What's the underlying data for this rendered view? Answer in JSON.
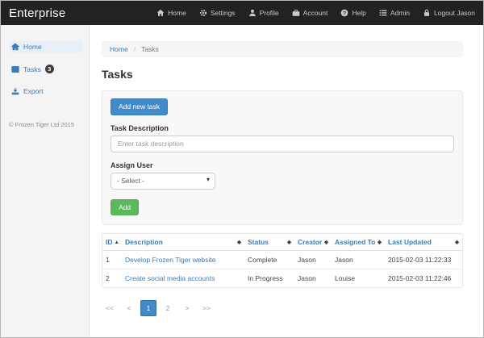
{
  "colors": {
    "navbar_bg": "#222222",
    "accent_blue": "#428bca",
    "link_blue": "#3c7cb7",
    "success_green": "#5cb85c",
    "sidebar_bg": "#f4f4f4",
    "badge_bg": "#3d3d3d"
  },
  "navbar": {
    "brand": "Enterprise",
    "items": [
      {
        "label": "Home",
        "icon": "home-icon"
      },
      {
        "label": "Settings",
        "icon": "gear-icon"
      },
      {
        "label": "Profile",
        "icon": "user-icon"
      },
      {
        "label": "Account",
        "icon": "briefcase-icon"
      },
      {
        "label": "Help",
        "icon": "help-circle-icon"
      },
      {
        "label": "Admin",
        "icon": "list-icon"
      },
      {
        "label": "Logout Jason",
        "icon": "lock-icon"
      }
    ]
  },
  "sidebar": {
    "items": [
      {
        "label": "Home",
        "icon": "home-icon",
        "active": true
      },
      {
        "label": "Tasks",
        "icon": "table-icon",
        "badge": "3"
      },
      {
        "label": "Export",
        "icon": "download-icon"
      }
    ],
    "copyright": "© Frozen Tiger Ltd 2015"
  },
  "breadcrumb": {
    "items": [
      "Home",
      "Tasks"
    ],
    "separator": "/"
  },
  "page": {
    "title": "Tasks"
  },
  "form": {
    "add_new_task_label": "Add new task",
    "task_description_label": "Task Description",
    "task_description_placeholder": "Enter task description",
    "assign_user_label": "Assign User",
    "assign_user_selected": "- Select -",
    "add_label": "Add"
  },
  "table": {
    "columns": [
      {
        "label": "ID",
        "sort_state": "ascending",
        "sort_glyph": "▲"
      },
      {
        "label": "Description",
        "sort_state": "sortable",
        "sort_glyph": "◆"
      },
      {
        "label": "Status",
        "sort_state": "sortable",
        "sort_glyph": "◆"
      },
      {
        "label": "Creator",
        "sort_state": "sortable",
        "sort_glyph": "◆"
      },
      {
        "label": "Assigned To",
        "sort_state": "sortable",
        "sort_glyph": "◆"
      },
      {
        "label": "Last Updated",
        "sort_state": "sortable",
        "sort_glyph": "◆"
      }
    ],
    "rows": [
      {
        "id": "1",
        "description": "Develop Frozen Tiger website",
        "status": "Complete",
        "creator": "Jason",
        "assigned_to": "Jason",
        "last_updated": "2015-02-03 11:22:33"
      },
      {
        "id": "2",
        "description": "Create social media accounts",
        "status": "In Progress",
        "creator": "Jason",
        "assigned_to": "Louise",
        "last_updated": "2015-02-03 11:22:46"
      }
    ]
  },
  "pagination": {
    "items": [
      {
        "label": "<<",
        "active": false
      },
      {
        "label": "<",
        "active": false
      },
      {
        "label": "1",
        "active": true
      },
      {
        "label": "2",
        "active": false
      },
      {
        "label": ">",
        "active": false
      },
      {
        "label": ">>",
        "active": false
      }
    ]
  }
}
